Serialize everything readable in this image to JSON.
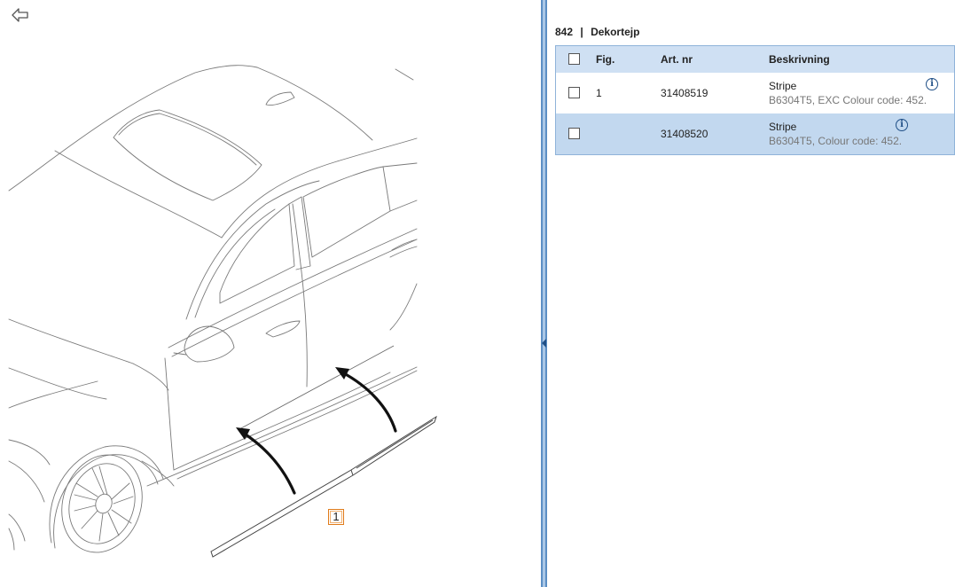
{
  "diagram": {
    "callout_label": "1"
  },
  "group": {
    "number": "842",
    "separator": "|",
    "name": "Dekortejp"
  },
  "table": {
    "headers": {
      "fig": "Fig.",
      "art": "Art. nr",
      "desc": "Beskrivning"
    },
    "rows": [
      {
        "fig": "1",
        "art": "31408519",
        "name": "Stripe",
        "sub": "B6304T5, EXC Colour code: 452.",
        "selected": false
      },
      {
        "fig": "",
        "art": "31408520",
        "name": "Stripe",
        "sub": "B6304T5, Colour code: 452.",
        "selected": false
      }
    ]
  },
  "icons": {
    "back": "back-arrow-icon",
    "info": "info-icon",
    "collapse": "collapse-left-icon"
  },
  "colors": {
    "header_bg": "#cfe0f3",
    "highlight_row": "#c2d8ef",
    "splitter": "#5b8ec4",
    "callout_border": "#e07b1a"
  }
}
